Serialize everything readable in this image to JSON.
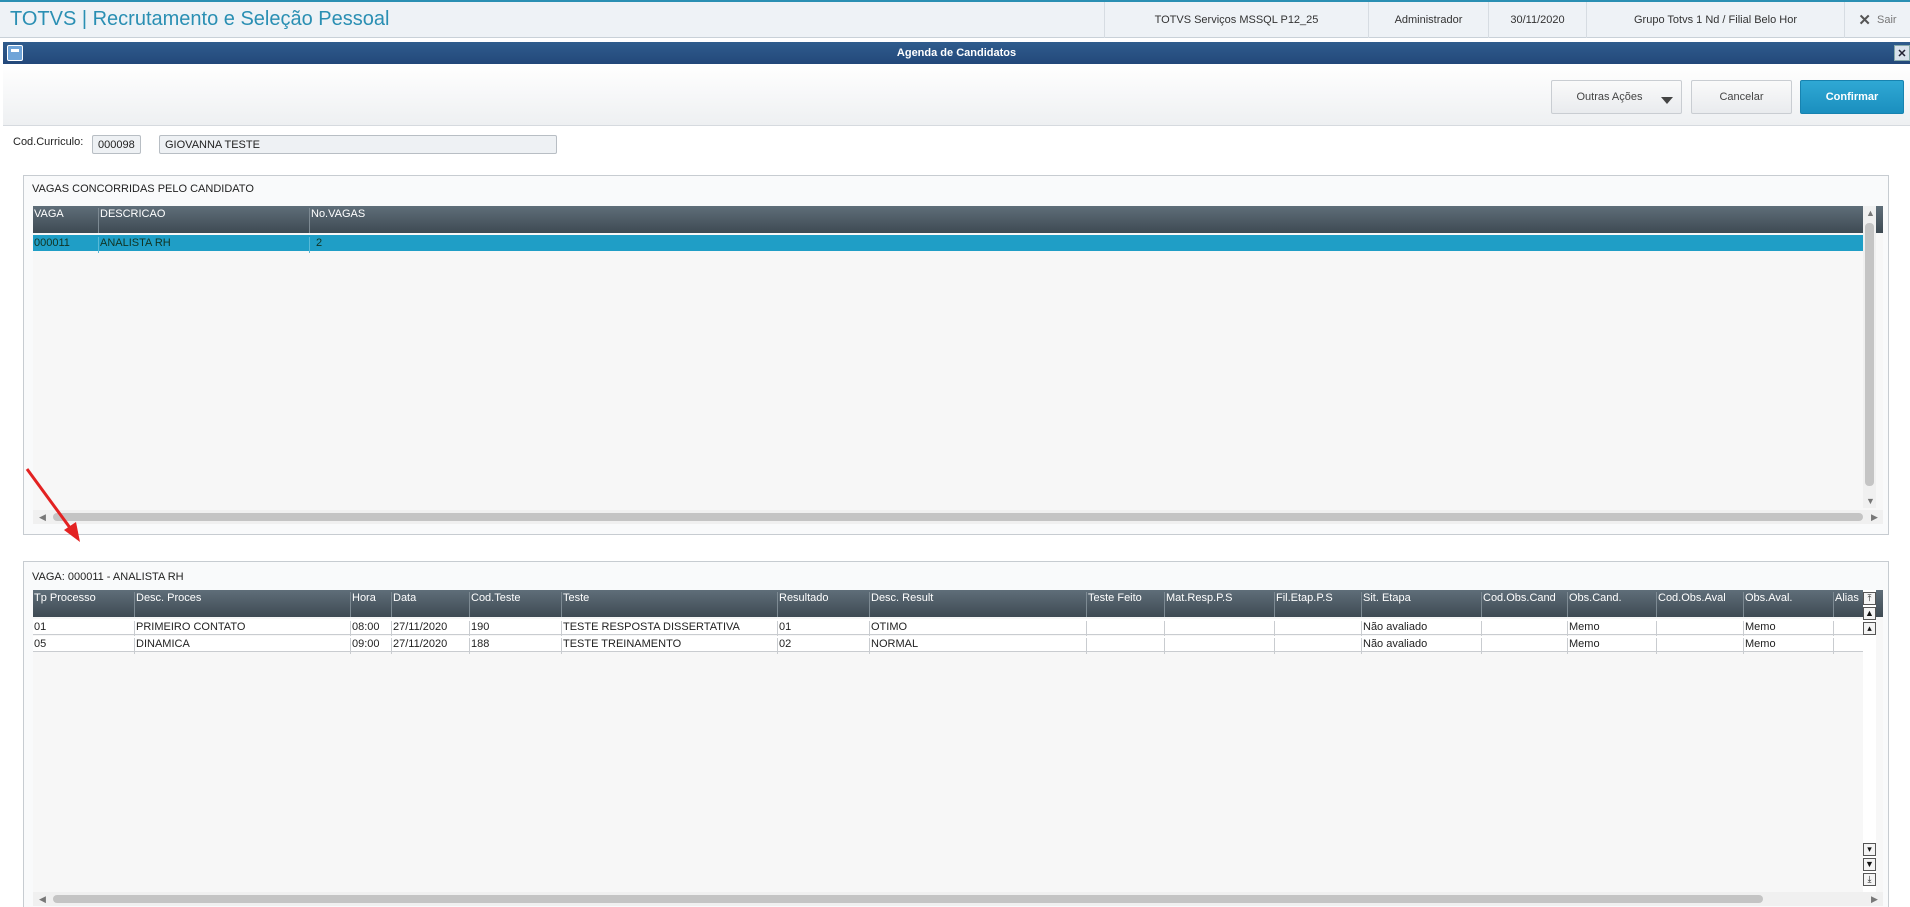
{
  "appbar": {
    "title": "TOTVS | Recrutamento e Seleção Pessoal",
    "environment": "TOTVS Serviços MSSQL P12_25",
    "user": "Administrador",
    "date": "30/11/2020",
    "branch": "Grupo Totvs 1 Nd / Filial Belo Hor",
    "exit_label": "Sair"
  },
  "dialog": {
    "title": "Agenda de Candidatos"
  },
  "toolbar": {
    "other_actions_label": "Outras Ações",
    "cancel_label": "Cancelar",
    "confirm_label": "Confirmar"
  },
  "form": {
    "cod_label": "Cod.Curriculo:",
    "cod_value": "000098",
    "name_value": "GIOVANNA  TESTE"
  },
  "vagas_panel": {
    "title": "VAGAS CONCORRIDAS PELO CANDIDATO",
    "columns": [
      "VAGA",
      "DESCRICAO",
      "No.VAGAS"
    ],
    "rows": [
      [
        "000011",
        "ANALISTA RH",
        "2"
      ]
    ]
  },
  "agenda_panel": {
    "title": "VAGA: 000011 - ANALISTA RH",
    "columns": [
      "Tp Processo",
      "Desc. Proces",
      "Hora",
      "Data",
      "Cod.Teste",
      "Teste",
      "Resultado",
      "Desc. Result",
      "Teste Feito",
      "Mat.Resp.P.S",
      "Fil.Etap.P.S",
      "Sit. Etapa",
      "Cod.Obs.Cand",
      "Obs.Cand.",
      "Cod.Obs.Aval",
      "Obs.Aval.",
      "Alias"
    ],
    "rows": [
      [
        "01",
        "PRIMEIRO CONTATO",
        "08:00",
        "27/11/2020",
        "190",
        "TESTE RESPOSTA DISSERTATIVA",
        "01",
        "OTIMO",
        "",
        "",
        "",
        "Não avaliado",
        "",
        "Memo",
        "",
        "Memo",
        ""
      ],
      [
        "05",
        "DINAMICA",
        "09:00",
        "27/11/2020",
        "188",
        "TESTE TREINAMENTO",
        "02",
        "NORMAL",
        "",
        "",
        "",
        "Não avaliado",
        "",
        "Memo",
        "",
        "Memo",
        ""
      ]
    ]
  },
  "colors": {
    "brand": "#2a8fb3",
    "dialog_bar": "#23487a",
    "selected_row": "#1f9ec6",
    "confirm_button": "#1b8fbf",
    "marker_arrow": "#e32222"
  },
  "icons": {
    "exit": "close-icon",
    "dialog_system": "window-icon",
    "dialog_close": "close-icon",
    "other_actions": "caret-down-icon",
    "first": "first-record-icon",
    "previous": "previous-record-icon",
    "next": "next-record-icon",
    "last": "last-record-icon"
  }
}
